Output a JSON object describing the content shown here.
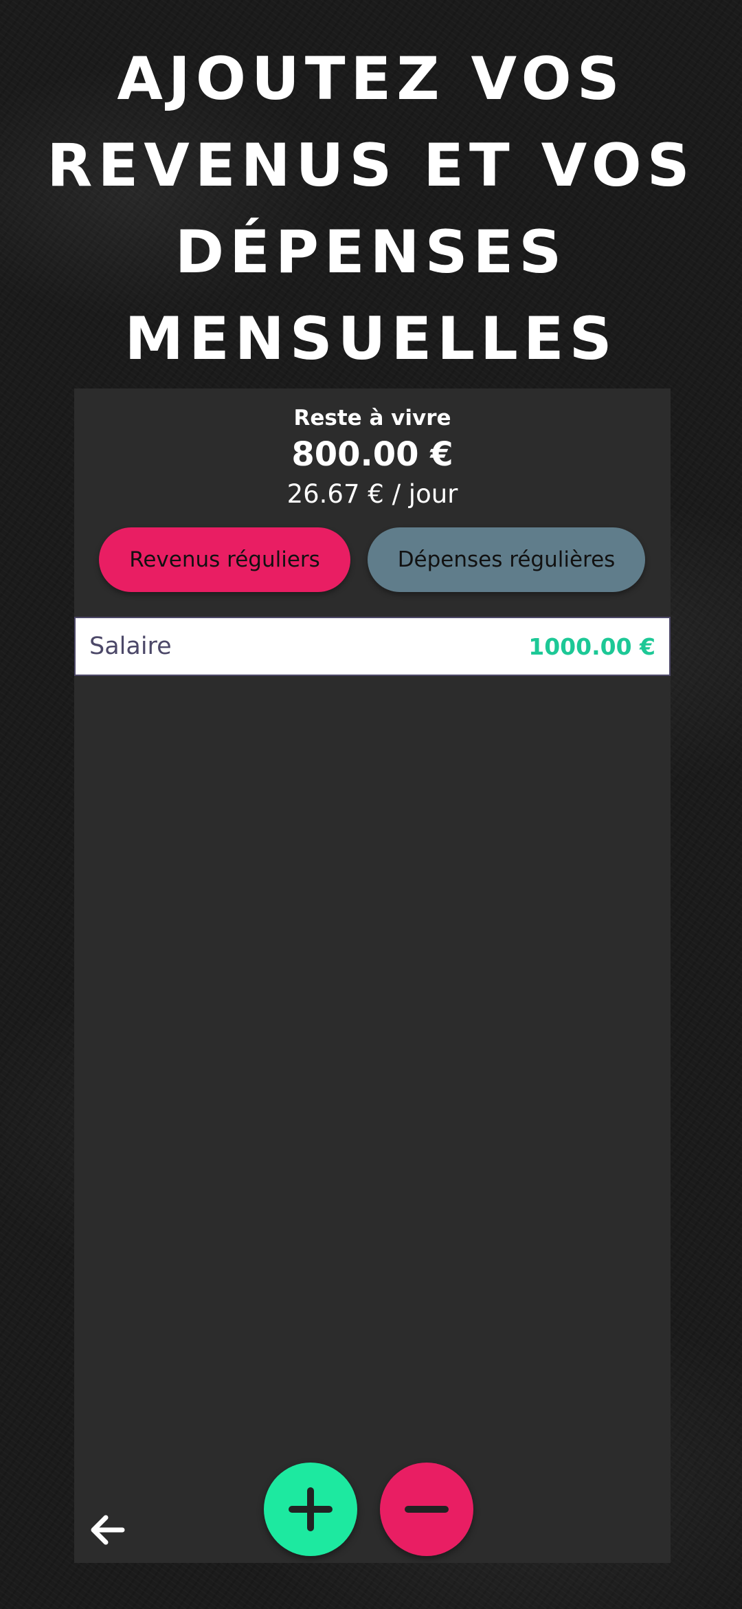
{
  "headline": "AJOUTEZ VOS\nREVENUS ET VOS\nDÉPENSES\nMENSUELLES",
  "summary": {
    "label": "Reste à vivre",
    "amount": "800.00 €",
    "daily": "26.67 € / jour"
  },
  "tabs": {
    "income_label": "Revenus réguliers",
    "expense_label": "Dépenses régulières",
    "active": "income"
  },
  "items": [
    {
      "name": "Salaire",
      "amount": "1000.00 €"
    }
  ],
  "actions": {
    "add_icon": "plus-icon",
    "remove_icon": "minus-icon",
    "back_icon": "arrow-left-icon"
  },
  "colors": {
    "income_accent": "#e91e63",
    "expense_tab": "#607d8b",
    "add_fab": "#1de9a0",
    "amount_positive": "#1dc896",
    "panel_background": "#2c2c2c"
  }
}
